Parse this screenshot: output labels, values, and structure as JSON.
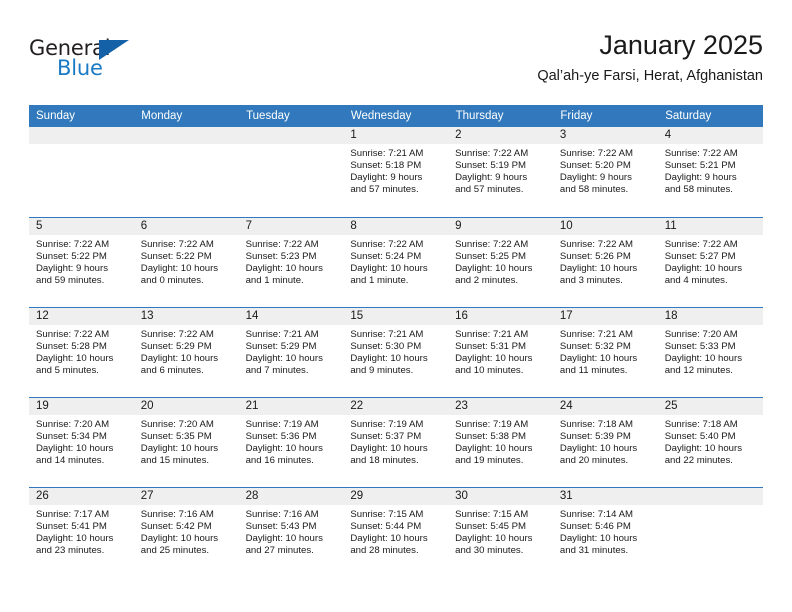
{
  "brand": {
    "name_dark": "General",
    "name_blue": "Blue",
    "accent_color": "#1461a8",
    "blue_text_color": "#1b7ac4"
  },
  "header": {
    "title": "January 2025",
    "subtitle": "Qal’ah-ye Farsi, Herat, Afghanistan"
  },
  "theme": {
    "header_bg": "#3179bc",
    "daynum_band_bg": "#efefef",
    "grid_line": "#3179bc"
  },
  "weekday_headers": [
    "Sunday",
    "Monday",
    "Tuesday",
    "Wednesday",
    "Thursday",
    "Friday",
    "Saturday"
  ],
  "labels": {
    "sunrise_prefix": "Sunrise:",
    "sunset_prefix": "Sunset:",
    "daylight_prefix": "Daylight:"
  },
  "weeks": [
    [
      {
        "day": "",
        "empty": true,
        "sunrise": "",
        "sunset": "",
        "daylight_line1": "",
        "daylight_line2": ""
      },
      {
        "day": "",
        "empty": true,
        "sunrise": "",
        "sunset": "",
        "daylight_line1": "",
        "daylight_line2": ""
      },
      {
        "day": "",
        "empty": true,
        "sunrise": "",
        "sunset": "",
        "daylight_line1": "",
        "daylight_line2": ""
      },
      {
        "day": "1",
        "empty": false,
        "sunrise": "Sunrise: 7:21 AM",
        "sunset": "Sunset: 5:18 PM",
        "daylight_line1": "Daylight: 9 hours",
        "daylight_line2": "and 57 minutes."
      },
      {
        "day": "2",
        "empty": false,
        "sunrise": "Sunrise: 7:22 AM",
        "sunset": "Sunset: 5:19 PM",
        "daylight_line1": "Daylight: 9 hours",
        "daylight_line2": "and 57 minutes."
      },
      {
        "day": "3",
        "empty": false,
        "sunrise": "Sunrise: 7:22 AM",
        "sunset": "Sunset: 5:20 PM",
        "daylight_line1": "Daylight: 9 hours",
        "daylight_line2": "and 58 minutes."
      },
      {
        "day": "4",
        "empty": false,
        "sunrise": "Sunrise: 7:22 AM",
        "sunset": "Sunset: 5:21 PM",
        "daylight_line1": "Daylight: 9 hours",
        "daylight_line2": "and 58 minutes."
      }
    ],
    [
      {
        "day": "5",
        "empty": false,
        "sunrise": "Sunrise: 7:22 AM",
        "sunset": "Sunset: 5:22 PM",
        "daylight_line1": "Daylight: 9 hours",
        "daylight_line2": "and 59 minutes."
      },
      {
        "day": "6",
        "empty": false,
        "sunrise": "Sunrise: 7:22 AM",
        "sunset": "Sunset: 5:22 PM",
        "daylight_line1": "Daylight: 10 hours",
        "daylight_line2": "and 0 minutes."
      },
      {
        "day": "7",
        "empty": false,
        "sunrise": "Sunrise: 7:22 AM",
        "sunset": "Sunset: 5:23 PM",
        "daylight_line1": "Daylight: 10 hours",
        "daylight_line2": "and 1 minute."
      },
      {
        "day": "8",
        "empty": false,
        "sunrise": "Sunrise: 7:22 AM",
        "sunset": "Sunset: 5:24 PM",
        "daylight_line1": "Daylight: 10 hours",
        "daylight_line2": "and 1 minute."
      },
      {
        "day": "9",
        "empty": false,
        "sunrise": "Sunrise: 7:22 AM",
        "sunset": "Sunset: 5:25 PM",
        "daylight_line1": "Daylight: 10 hours",
        "daylight_line2": "and 2 minutes."
      },
      {
        "day": "10",
        "empty": false,
        "sunrise": "Sunrise: 7:22 AM",
        "sunset": "Sunset: 5:26 PM",
        "daylight_line1": "Daylight: 10 hours",
        "daylight_line2": "and 3 minutes."
      },
      {
        "day": "11",
        "empty": false,
        "sunrise": "Sunrise: 7:22 AM",
        "sunset": "Sunset: 5:27 PM",
        "daylight_line1": "Daylight: 10 hours",
        "daylight_line2": "and 4 minutes."
      }
    ],
    [
      {
        "day": "12",
        "empty": false,
        "sunrise": "Sunrise: 7:22 AM",
        "sunset": "Sunset: 5:28 PM",
        "daylight_line1": "Daylight: 10 hours",
        "daylight_line2": "and 5 minutes."
      },
      {
        "day": "13",
        "empty": false,
        "sunrise": "Sunrise: 7:22 AM",
        "sunset": "Sunset: 5:29 PM",
        "daylight_line1": "Daylight: 10 hours",
        "daylight_line2": "and 6 minutes."
      },
      {
        "day": "14",
        "empty": false,
        "sunrise": "Sunrise: 7:21 AM",
        "sunset": "Sunset: 5:29 PM",
        "daylight_line1": "Daylight: 10 hours",
        "daylight_line2": "and 7 minutes."
      },
      {
        "day": "15",
        "empty": false,
        "sunrise": "Sunrise: 7:21 AM",
        "sunset": "Sunset: 5:30 PM",
        "daylight_line1": "Daylight: 10 hours",
        "daylight_line2": "and 9 minutes."
      },
      {
        "day": "16",
        "empty": false,
        "sunrise": "Sunrise: 7:21 AM",
        "sunset": "Sunset: 5:31 PM",
        "daylight_line1": "Daylight: 10 hours",
        "daylight_line2": "and 10 minutes."
      },
      {
        "day": "17",
        "empty": false,
        "sunrise": "Sunrise: 7:21 AM",
        "sunset": "Sunset: 5:32 PM",
        "daylight_line1": "Daylight: 10 hours",
        "daylight_line2": "and 11 minutes."
      },
      {
        "day": "18",
        "empty": false,
        "sunrise": "Sunrise: 7:20 AM",
        "sunset": "Sunset: 5:33 PM",
        "daylight_line1": "Daylight: 10 hours",
        "daylight_line2": "and 12 minutes."
      }
    ],
    [
      {
        "day": "19",
        "empty": false,
        "sunrise": "Sunrise: 7:20 AM",
        "sunset": "Sunset: 5:34 PM",
        "daylight_line1": "Daylight: 10 hours",
        "daylight_line2": "and 14 minutes."
      },
      {
        "day": "20",
        "empty": false,
        "sunrise": "Sunrise: 7:20 AM",
        "sunset": "Sunset: 5:35 PM",
        "daylight_line1": "Daylight: 10 hours",
        "daylight_line2": "and 15 minutes."
      },
      {
        "day": "21",
        "empty": false,
        "sunrise": "Sunrise: 7:19 AM",
        "sunset": "Sunset: 5:36 PM",
        "daylight_line1": "Daylight: 10 hours",
        "daylight_line2": "and 16 minutes."
      },
      {
        "day": "22",
        "empty": false,
        "sunrise": "Sunrise: 7:19 AM",
        "sunset": "Sunset: 5:37 PM",
        "daylight_line1": "Daylight: 10 hours",
        "daylight_line2": "and 18 minutes."
      },
      {
        "day": "23",
        "empty": false,
        "sunrise": "Sunrise: 7:19 AM",
        "sunset": "Sunset: 5:38 PM",
        "daylight_line1": "Daylight: 10 hours",
        "daylight_line2": "and 19 minutes."
      },
      {
        "day": "24",
        "empty": false,
        "sunrise": "Sunrise: 7:18 AM",
        "sunset": "Sunset: 5:39 PM",
        "daylight_line1": "Daylight: 10 hours",
        "daylight_line2": "and 20 minutes."
      },
      {
        "day": "25",
        "empty": false,
        "sunrise": "Sunrise: 7:18 AM",
        "sunset": "Sunset: 5:40 PM",
        "daylight_line1": "Daylight: 10 hours",
        "daylight_line2": "and 22 minutes."
      }
    ],
    [
      {
        "day": "26",
        "empty": false,
        "sunrise": "Sunrise: 7:17 AM",
        "sunset": "Sunset: 5:41 PM",
        "daylight_line1": "Daylight: 10 hours",
        "daylight_line2": "and 23 minutes."
      },
      {
        "day": "27",
        "empty": false,
        "sunrise": "Sunrise: 7:16 AM",
        "sunset": "Sunset: 5:42 PM",
        "daylight_line1": "Daylight: 10 hours",
        "daylight_line2": "and 25 minutes."
      },
      {
        "day": "28",
        "empty": false,
        "sunrise": "Sunrise: 7:16 AM",
        "sunset": "Sunset: 5:43 PM",
        "daylight_line1": "Daylight: 10 hours",
        "daylight_line2": "and 27 minutes."
      },
      {
        "day": "29",
        "empty": false,
        "sunrise": "Sunrise: 7:15 AM",
        "sunset": "Sunset: 5:44 PM",
        "daylight_line1": "Daylight: 10 hours",
        "daylight_line2": "and 28 minutes."
      },
      {
        "day": "30",
        "empty": false,
        "sunrise": "Sunrise: 7:15 AM",
        "sunset": "Sunset: 5:45 PM",
        "daylight_line1": "Daylight: 10 hours",
        "daylight_line2": "and 30 minutes."
      },
      {
        "day": "31",
        "empty": false,
        "sunrise": "Sunrise: 7:14 AM",
        "sunset": "Sunset: 5:46 PM",
        "daylight_line1": "Daylight: 10 hours",
        "daylight_line2": "and 31 minutes."
      },
      {
        "day": "",
        "empty": true,
        "sunrise": "",
        "sunset": "",
        "daylight_line1": "",
        "daylight_line2": ""
      }
    ]
  ]
}
